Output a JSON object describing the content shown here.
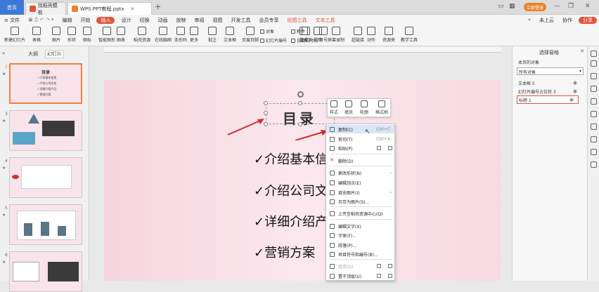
{
  "titlebar": {
    "home_tab": "首页",
    "tabs": [
      {
        "label": "找稻壳模板",
        "icon_color": "#e2533b"
      },
      {
        "label": "WPS PPT教程.pptx",
        "icon_color": "#e8832a"
      }
    ],
    "new_tab": "+",
    "login_button": "立即登录"
  },
  "menubar": {
    "items": [
      "≡ 文件",
      "开始",
      "插入",
      "设计",
      "切换",
      "动画",
      "放映",
      "审阅",
      "视图",
      "开发工具",
      "会员专享",
      "绘图工具",
      "文本工具"
    ],
    "active": "插入",
    "edit_label": "编辑",
    "right": [
      "未上云",
      "协作",
      "分享"
    ]
  },
  "ribbon": {
    "large": [
      "新建幻灯片",
      "表格",
      "图片",
      "形状",
      "图标",
      "智能图形",
      "图表",
      "稻壳资源",
      "在线脑图",
      "条形码",
      "更多",
      "批注",
      "文本框",
      "页眉页脚",
      "艺术字",
      "符号",
      "公式",
      "视频",
      "屏幕录制",
      "超链接",
      "动作",
      "资源夹",
      "教学工具"
    ],
    "small": [
      "对象",
      "幻灯片编号",
      "附件",
      "日期和时间"
    ]
  },
  "left_panel": {
    "tabs": [
      "大纲",
      "幻灯片"
    ],
    "active_tab": "幻灯片",
    "slide_numbers": [
      "2",
      "3",
      "4",
      "5",
      "6"
    ],
    "thumb2": {
      "title": "目录",
      "lines": [
        "✓介绍基本信息",
        "✓介绍公司文化",
        "✓详细介绍产品",
        "✓营销方案"
      ]
    }
  },
  "slide": {
    "title": "目录",
    "bullets": [
      "✓介绍基本信",
      "✓介绍公司文",
      "✓详细介绍产",
      "✓营销方案"
    ]
  },
  "mini_toolbar": [
    "样式",
    "填充",
    "轮廓",
    "格式刷"
  ],
  "context_menu": {
    "items": [
      {
        "label": "复制(C)",
        "shortcut": "Ctrl+C"
      },
      {
        "label": "剪切(T)",
        "shortcut": "Ctrl+X"
      },
      {
        "label": "粘贴(P)",
        "shortcut": ""
      },
      {
        "label": "删除(D)",
        "shortcut": ""
      },
      {
        "label": "更改形状(N)",
        "shortcut": ""
      },
      {
        "label": "编辑顶点(E)",
        "shortcut": ""
      },
      {
        "label": "填充图片(I)",
        "shortcut": ""
      },
      {
        "label": "另存为图片(S)...",
        "shortcut": ""
      },
      {
        "label": "上传至稻壳资源中心(Q)",
        "shortcut": ""
      },
      {
        "label": "编辑文字(X)",
        "shortcut": ""
      },
      {
        "label": "字体(F)...",
        "shortcut": ""
      },
      {
        "label": "段落(P)...",
        "shortcut": ""
      },
      {
        "label": "项目符号和编号(B)...",
        "shortcut": ""
      },
      {
        "label": "组合(G)",
        "shortcut": ""
      },
      {
        "label": "置于顶层(U)",
        "shortcut": ""
      }
    ]
  },
  "right_panel": {
    "title": "选择窗格",
    "section": "本页的对象",
    "dropdown": "所有对象",
    "objects": [
      "文本框 5",
      "幻灯片编号占位符 3",
      "标题 1"
    ]
  },
  "colors": {
    "accent": "#e2533b",
    "wps_blue": "#3c78d8",
    "arrow": "#d42a2a"
  }
}
